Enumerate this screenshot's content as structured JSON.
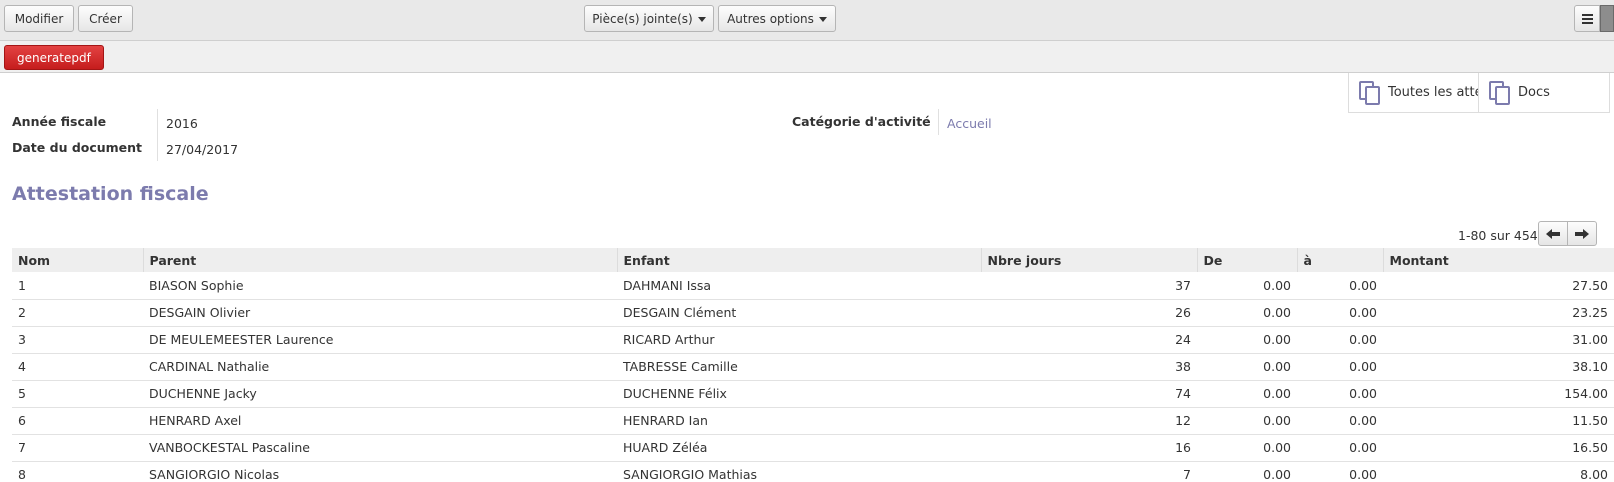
{
  "toolbar": {
    "modify_label": "Modifier",
    "create_label": "Créer",
    "attachments_label": "Pièce(s) jointe(s)",
    "more_label": "Autres options"
  },
  "statusbar": {
    "generate_label": "generatepdf"
  },
  "smart_buttons": {
    "all_certificates": "Toutes les attesta",
    "docs": "Docs"
  },
  "form": {
    "fiscal_year_label": "Année fiscale",
    "fiscal_year_value": "2016",
    "doc_date_label": "Date du document",
    "doc_date_value": "27/04/2017",
    "category_label": "Catégorie d'activité",
    "category_value": "Accueil",
    "section_title": "Attestation fiscale"
  },
  "pager": {
    "text": "1-80 sur 454"
  },
  "table": {
    "headers": {
      "nom": "Nom",
      "parent": "Parent",
      "enfant": "Enfant",
      "jours": "Nbre jours",
      "de": "De",
      "a": "à",
      "montant": "Montant"
    },
    "rows": [
      {
        "nom": "1",
        "parent": "BIASON Sophie",
        "enfant": "DAHMANI Issa",
        "jours": "37",
        "de": "0.00",
        "a": "0.00",
        "montant": "27.50"
      },
      {
        "nom": "2",
        "parent": "DESGAIN Olivier",
        "enfant": "DESGAIN Clément",
        "jours": "26",
        "de": "0.00",
        "a": "0.00",
        "montant": "23.25"
      },
      {
        "nom": "3",
        "parent": "DE MEULEMEESTER Laurence",
        "enfant": "RICARD Arthur",
        "jours": "24",
        "de": "0.00",
        "a": "0.00",
        "montant": "31.00"
      },
      {
        "nom": "4",
        "parent": "CARDINAL Nathalie",
        "enfant": "TABRESSE Camille",
        "jours": "38",
        "de": "0.00",
        "a": "0.00",
        "montant": "38.10"
      },
      {
        "nom": "5",
        "parent": "DUCHENNE Jacky",
        "enfant": "DUCHENNE Félix",
        "jours": "74",
        "de": "0.00",
        "a": "0.00",
        "montant": "154.00"
      },
      {
        "nom": "6",
        "parent": "HENRARD Axel",
        "enfant": "HENRARD Ian",
        "jours": "12",
        "de": "0.00",
        "a": "0.00",
        "montant": "11.50"
      },
      {
        "nom": "7",
        "parent": "VANBOCKESTAL Pascaline",
        "enfant": "HUARD Zéléa",
        "jours": "16",
        "de": "0.00",
        "a": "0.00",
        "montant": "16.50"
      },
      {
        "nom": "8",
        "parent": "SANGIORGIO Nicolas",
        "enfant": "SANGIORGIO Mathias",
        "jours": "7",
        "de": "0.00",
        "a": "0.00",
        "montant": "8.00"
      }
    ]
  }
}
